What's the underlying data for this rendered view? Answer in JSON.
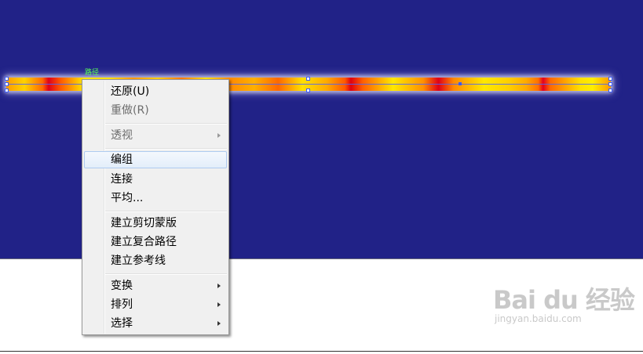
{
  "canvas": {
    "background_color": "#212287"
  },
  "artwork": {
    "path_label": "路径",
    "stroke_colors": [
      "#ffe600",
      "#ff8c00",
      "#e00018"
    ]
  },
  "context_menu": {
    "items": [
      {
        "label": "还原(U)",
        "disabled": false,
        "submenu": false
      },
      {
        "label": "重做(R)",
        "disabled": true,
        "submenu": false
      },
      {
        "label": "透视",
        "disabled": true,
        "submenu": true
      },
      {
        "label": "编组",
        "disabled": false,
        "submenu": false,
        "highlighted": true
      },
      {
        "label": "连接",
        "disabled": false,
        "submenu": false
      },
      {
        "label": "平均...",
        "disabled": false,
        "submenu": false
      },
      {
        "label": "建立剪切蒙版",
        "disabled": false,
        "submenu": false
      },
      {
        "label": "建立复合路径",
        "disabled": false,
        "submenu": false
      },
      {
        "label": "建立参考线",
        "disabled": false,
        "submenu": false
      },
      {
        "label": "变换",
        "disabled": false,
        "submenu": true
      },
      {
        "label": "排列",
        "disabled": false,
        "submenu": true
      },
      {
        "label": "选择",
        "disabled": false,
        "submenu": true
      }
    ]
  },
  "watermark": {
    "logo_text": "Bai du 经验",
    "url_text": "jingyan.baidu.com"
  }
}
